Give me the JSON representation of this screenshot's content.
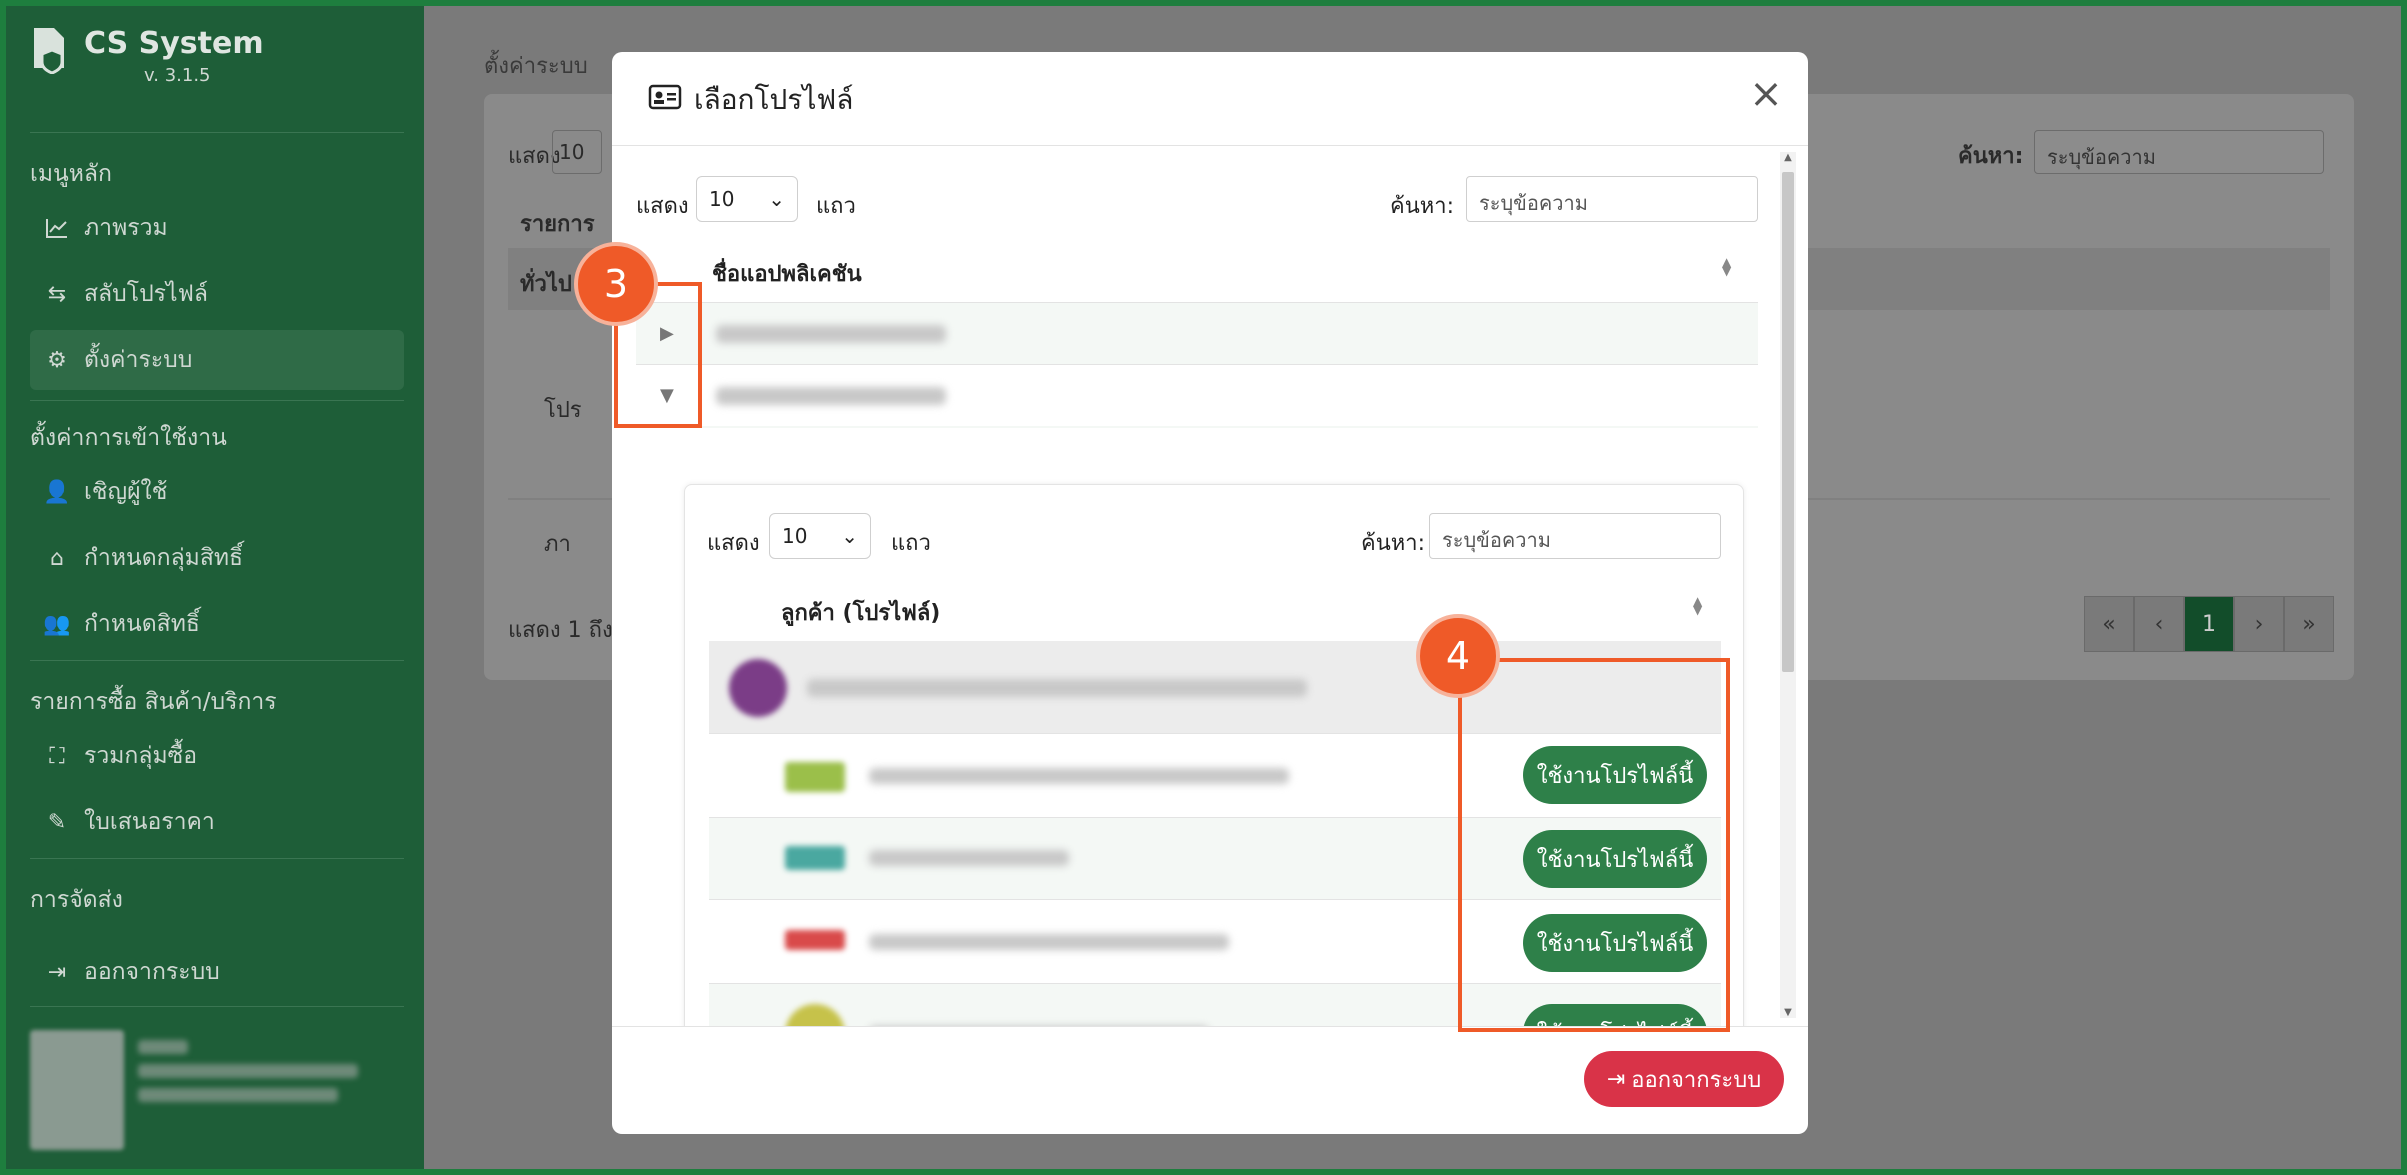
{
  "app": {
    "name": "CS System",
    "version": "v. 3.1.5"
  },
  "sidebar": {
    "sections": [
      {
        "heading": "เมนูหลัก",
        "items": [
          {
            "label": "ภาพรวม",
            "icon": "chart-line-icon"
          },
          {
            "label": "สลับโปรไฟล์",
            "icon": "swap-icon"
          },
          {
            "label": "ตั้งค่าระบบ",
            "icon": "gear-icon",
            "active": true
          }
        ]
      },
      {
        "heading": "ตั้งค่าการเข้าใช้งาน",
        "items": [
          {
            "label": "เชิญผู้ใช้",
            "icon": "user-plus-icon"
          },
          {
            "label": "กำหนดกลุ่มสิทธิ์",
            "icon": "users-group-icon"
          },
          {
            "label": "กำหนดสิทธิ์",
            "icon": "users-icon"
          }
        ]
      },
      {
        "heading": "รายการซื้อ สินค้า/บริการ",
        "items": [
          {
            "label": "รวมกลุ่มซื้อ",
            "icon": "group-icon"
          },
          {
            "label": "ใบเสนอราคา",
            "icon": "file-edit-icon"
          }
        ]
      },
      {
        "heading": "การจัดส่ง",
        "items": [
          {
            "label": "ออกจากระบบ",
            "icon": "logout-icon"
          }
        ]
      }
    ]
  },
  "background_page": {
    "breadcrumb": "ตั้งค่าระบบ",
    "show_label": "แสดง",
    "show_value": "10",
    "search_label": "ค้นหา:",
    "search_placeholder": "ระบุข้อความ",
    "col_header": "รายการ",
    "row1": "ทั่วไป",
    "row2": "โปร",
    "row3": "ภา",
    "footer": "แสดง 1 ถึง",
    "pager": [
      "«",
      "‹",
      "1",
      "›",
      "»"
    ]
  },
  "modal": {
    "title": "เลือกโปรไฟล์",
    "show_label": "แสดง",
    "show_value": "10",
    "rows_label": "แถว",
    "search_label": "ค้นหา:",
    "search_placeholder": "ระบุข้อความ",
    "col_app": "ชื่อแอปพลิเคชัน",
    "nested": {
      "show_label": "แสดง",
      "show_value": "10",
      "rows_label": "แถว",
      "search_label": "ค้นหา:",
      "search_placeholder": "ระบุข้อความ",
      "col_customer": "ลูกค้า (โปรไฟล์)",
      "use_button": "ใช้งานโปรไฟล์นี้"
    },
    "logout_button": "ออกจากระบบ"
  },
  "annotations": {
    "step3": "3",
    "step4": "4"
  },
  "colors": {
    "sidebar": "#1e5e38",
    "accent": "#2e8049",
    "danger": "#d93348",
    "callout": "#ef5a28"
  }
}
